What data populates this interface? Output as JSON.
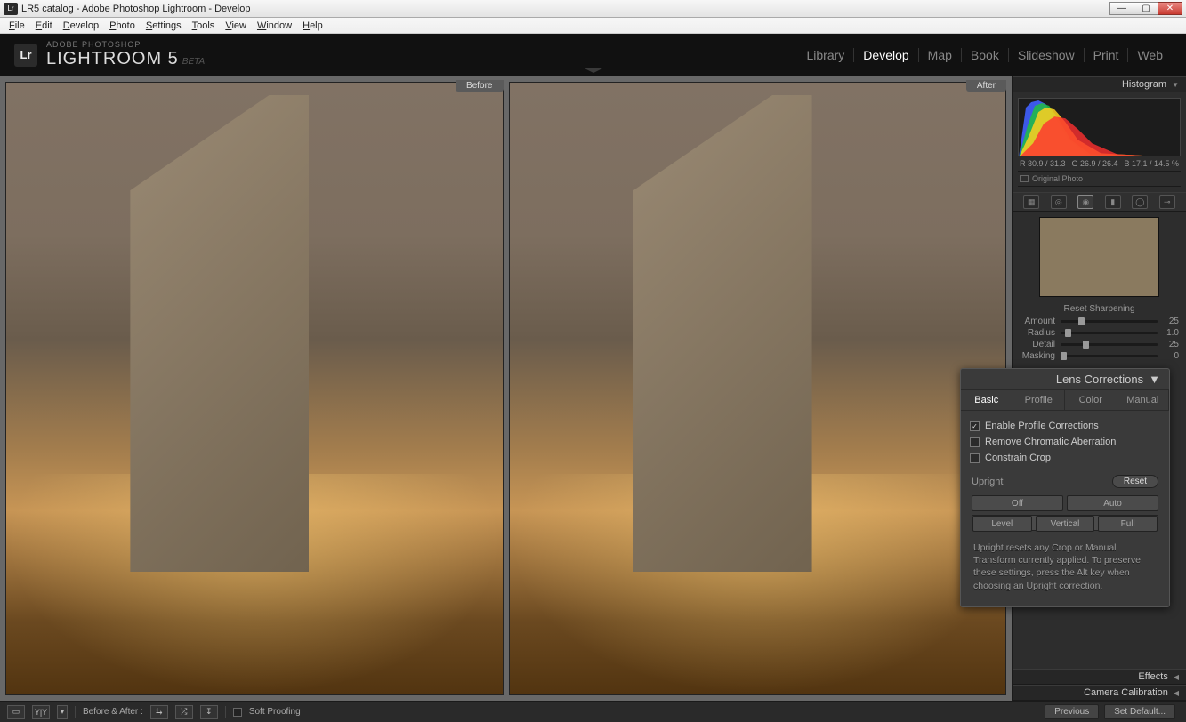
{
  "window": {
    "title": "LR5 catalog - Adobe Photoshop Lightroom - Develop"
  },
  "menubar": [
    "File",
    "Edit",
    "Develop",
    "Photo",
    "Settings",
    "Tools",
    "View",
    "Window",
    "Help"
  ],
  "brand": {
    "mark": "Lr",
    "line1": "ADOBE PHOTOSHOP",
    "product": "LIGHTROOM 5",
    "tag": "BETA"
  },
  "modules": [
    {
      "t": "Library",
      "active": false
    },
    {
      "t": "Develop",
      "active": true
    },
    {
      "t": "Map",
      "active": false
    },
    {
      "t": "Book",
      "active": false
    },
    {
      "t": "Slideshow",
      "active": false
    },
    {
      "t": "Print",
      "active": false
    },
    {
      "t": "Web",
      "active": false
    }
  ],
  "compare": {
    "before": "Before",
    "after": "After"
  },
  "right": {
    "histogram": {
      "title": "Histogram",
      "meta": [
        "R 30.9 / 31.3",
        "G 26.9 / 26.4",
        "B 17.1 / 14.5  %"
      ],
      "original": "Original Photo"
    },
    "tools": [
      "crop",
      "spot",
      "redeye",
      "grad",
      "radial",
      "brush"
    ],
    "sharpening": {
      "reset": "Reset Sharpening",
      "rows": [
        {
          "lbl": "Amount",
          "val": "25",
          "pos": 0.18
        },
        {
          "lbl": "Radius",
          "val": "1.0",
          "pos": 0.05
        },
        {
          "lbl": "Detail",
          "val": "25",
          "pos": 0.23
        },
        {
          "lbl": "Masking",
          "val": "0",
          "pos": 0.0
        }
      ]
    },
    "collapsed": [
      {
        "t": "Effects"
      },
      {
        "t": "Camera Calibration"
      }
    ]
  },
  "lens": {
    "title": "Lens Corrections",
    "tabs": [
      {
        "t": "Basic",
        "active": true
      },
      {
        "t": "Profile",
        "active": false
      },
      {
        "t": "Color",
        "active": false
      },
      {
        "t": "Manual",
        "active": false
      }
    ],
    "checks": [
      {
        "t": "Enable Profile Corrections",
        "on": true
      },
      {
        "t": "Remove Chromatic Aberration",
        "on": false
      },
      {
        "t": "Constrain Crop",
        "on": false
      }
    ],
    "upright": "Upright",
    "reset": "Reset",
    "buttons": [
      "Off",
      "Auto",
      "Level",
      "Vertical",
      "Full"
    ],
    "note": "Upright resets any Crop or Manual Transform currently applied. To preserve these settings, press the Alt key when choosing an Upright correction."
  },
  "bottombar": {
    "label": "Before & After :",
    "soft": "Soft Proofing",
    "prev": "Previous",
    "setdef": "Set Default..."
  }
}
